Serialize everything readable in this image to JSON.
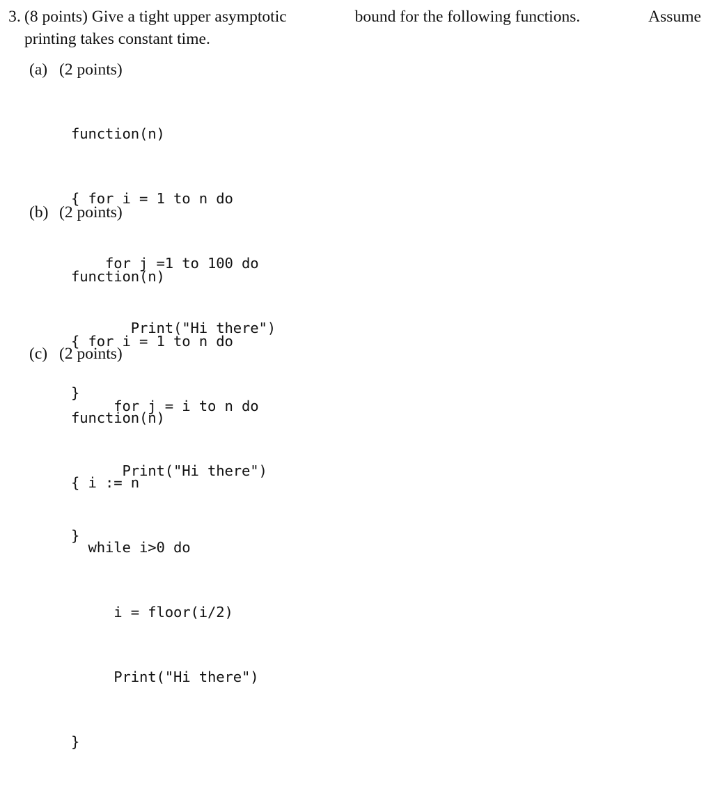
{
  "document": {
    "type": "exam-question",
    "background_color": "#ffffff",
    "text_color": "#111111"
  },
  "question": {
    "number": "3.",
    "line1_left": "(8 points)  Give  a  tight  upper  asymptotic",
    "line1_right": "bound  for  the  following  functions.",
    "line1_tail": "Assume",
    "line1_full": "(8 points) Give a tight upper asymptotic bound for the following functions.  Assume",
    "line2": "printing takes constant time."
  },
  "parts": [
    {
      "label": "(a)",
      "points": "(2 points)",
      "code": [
        "function(n)",
        "{ for i = 1 to n do",
        "    for j =1 to 100 do",
        "       Print(\"Hi there\")",
        "}"
      ]
    },
    {
      "label": "(b)",
      "points": "(2 points)",
      "code": [
        "function(n)",
        "{ for i = 1 to n do",
        "     for j = i to n do",
        "      Print(\"Hi there\")",
        "}"
      ]
    },
    {
      "label": "(c)",
      "points": "(2 points)",
      "code": [
        "function(n)",
        "{ i := n",
        "  while i>0 do",
        "     i = floor(i/2)",
        "     Print(\"Hi there\")",
        "}"
      ]
    }
  ]
}
